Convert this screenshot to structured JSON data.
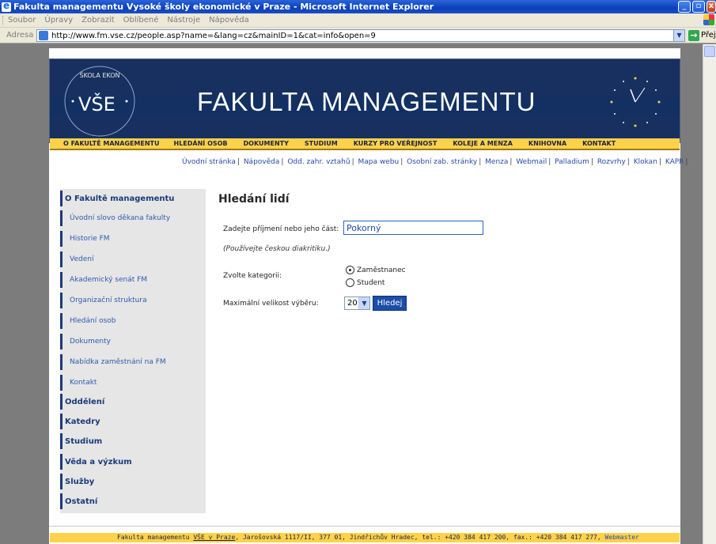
{
  "window": {
    "title": "Fakulta managementu Vysoké školy ekonomické v Praze - Microsoft Internet Explorer",
    "min": "_",
    "max": "▫",
    "close": "x"
  },
  "menubar": {
    "items": [
      "Soubor",
      "Úpravy",
      "Zobrazit",
      "Oblíbené",
      "Nástroje",
      "Nápověda"
    ]
  },
  "addressbar": {
    "label": "Adresa",
    "url": "http://www.fm.vse.cz/people.asp?name=&lang=cz&mainID=1&cat=info&open=9",
    "go_label": "Přej"
  },
  "header": {
    "logo_text": "VŠE",
    "logo_ring_top": "ŠKOLA EKON",
    "title": "FAKULTA MANAGEMENTU"
  },
  "topnav": {
    "items": [
      "O FAKULTĚ MANAGEMENTU",
      "HLEDÁNÍ OSOB",
      "DOKUMENTY",
      "STUDIUM",
      "KURZY PRO VEŘEJNOST",
      "KOLEJE A MENZA",
      "KNIHOVNA",
      "KONTAKT"
    ]
  },
  "quicklinks": {
    "items": [
      "Úvodní stránka",
      "Nápověda",
      "Odd. zahr. vztahů",
      "Mapa webu",
      "Osobní zab. stránky",
      "Menza",
      "Webmail",
      "Palladium",
      "Rozvrhy",
      "Klokan",
      "KAPR"
    ]
  },
  "sidebar": {
    "items": [
      {
        "label": "O Fakultě managementu",
        "type": "head"
      },
      {
        "label": "Úvodní slovo děkana fakulty",
        "type": "sub"
      },
      {
        "label": "Historie FM",
        "type": "sub"
      },
      {
        "label": "Vedení",
        "type": "sub"
      },
      {
        "label": "Akademický senát FM",
        "type": "sub"
      },
      {
        "label": "Organizační struktura",
        "type": "sub"
      },
      {
        "label": "Hledání osob",
        "type": "sub"
      },
      {
        "label": "Dokumenty",
        "type": "sub"
      },
      {
        "label": "Nabídka zaměstnání na FM",
        "type": "sub"
      },
      {
        "label": "Kontakt",
        "type": "sub"
      },
      {
        "label": "Oddělení",
        "type": "head"
      },
      {
        "label": "Katedry",
        "type": "head"
      },
      {
        "label": "Studium",
        "type": "head"
      },
      {
        "label": "Věda a výzkum",
        "type": "head"
      },
      {
        "label": "Služby",
        "type": "head"
      },
      {
        "label": "Ostatní",
        "type": "head"
      }
    ]
  },
  "search": {
    "title": "Hledání lidí",
    "surname_label": "Zadejte příjmení nebo jeho část:",
    "surname_value": "Pokorný",
    "hint": "(Používejte českou diakritiku.)",
    "category_label": "Zvolte kategorii:",
    "category_options": [
      "Zaměstnanec",
      "Student"
    ],
    "category_selected": "Zaměstnanec",
    "max_label": "Maximální velikost výběru:",
    "max_value": "20",
    "button_label": "Hledej"
  },
  "footer": {
    "text_a": "Fakulta managementu ",
    "text_link": "VŠE v Praze",
    "text_b": ", Jarošovská 1117/II, 377 01, Jindřichův Hradec, tel.: +420 384 417 200, fax.: +420 384 417 277, ",
    "webmaster": "Webmaster"
  },
  "colors": {
    "header_bg": "#17305f",
    "nav_bg": "#ffd24a",
    "sidebar_bg": "#e6e6e6",
    "link_blue": "#2a4aa6"
  }
}
